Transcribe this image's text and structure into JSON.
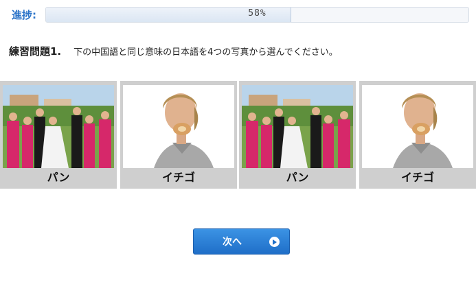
{
  "progress": {
    "label": "進捗:",
    "percent": 58,
    "text": "58%"
  },
  "question": {
    "title": "練習問題1.",
    "text": "下の中国語と同じ意味の日本語を4つの写真から選んでください。"
  },
  "choices": [
    {
      "caption": "パン",
      "image": "wedding-party-photo"
    },
    {
      "caption": "イチゴ",
      "image": "person-eating-bread-photo"
    },
    {
      "caption": "パン",
      "image": "wedding-party-photo"
    },
    {
      "caption": "イチゴ",
      "image": "person-eating-bread-photo"
    }
  ],
  "next_button": {
    "label": "次へ",
    "icon": "play-circle-icon"
  },
  "colors": {
    "accent": "#2a73c8",
    "button": "#1f6fc8",
    "choice_bg": "#cfcfcf"
  }
}
